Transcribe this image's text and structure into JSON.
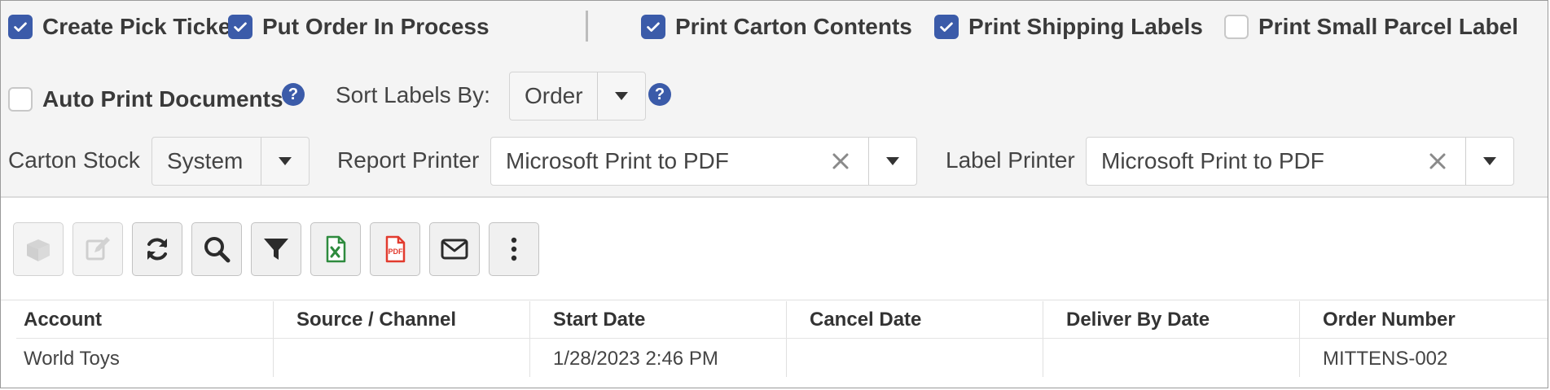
{
  "options": {
    "create_pick_tickets": {
      "label": "Create Pick Tickets",
      "checked": true
    },
    "put_order_in_process": {
      "label": "Put Order In Process",
      "checked": true
    },
    "print_carton_contents": {
      "label": "Print Carton Contents",
      "checked": true
    },
    "print_shipping_labels": {
      "label": "Print Shipping Labels",
      "checked": true
    },
    "print_small_parcel_label": {
      "label": "Print Small Parcel Label",
      "checked": false
    },
    "auto_print_documents": {
      "label": "Auto Print Documents",
      "checked": false
    }
  },
  "help_glyph": "?",
  "sort_labels": {
    "label": "Sort Labels By:",
    "value": "Order"
  },
  "carton_stock": {
    "label": "Carton Stock",
    "value": "System"
  },
  "report_printer": {
    "label": "Report Printer",
    "value": "Microsoft Print to PDF"
  },
  "label_printer": {
    "label": "Label Printer",
    "value": "Microsoft Print to PDF"
  },
  "toolbar": {
    "buttons": [
      {
        "icon": "box-icon",
        "enabled": false
      },
      {
        "icon": "edit-icon",
        "enabled": false
      },
      {
        "icon": "refresh-icon",
        "enabled": true
      },
      {
        "icon": "search-icon",
        "enabled": true
      },
      {
        "icon": "filter-icon",
        "enabled": true
      },
      {
        "icon": "excel-export-icon",
        "enabled": true
      },
      {
        "icon": "pdf-export-icon",
        "enabled": true
      },
      {
        "icon": "email-icon",
        "enabled": true
      },
      {
        "icon": "more-options-icon",
        "enabled": true
      }
    ],
    "pdf_text": "PDF"
  },
  "colors": {
    "checkbox_accent": "#3b5ba9",
    "excel_green": "#2e8b3e",
    "pdf_red": "#e23b2e"
  },
  "table": {
    "columns": [
      "Account",
      "Source / Channel",
      "Start Date",
      "Cancel Date",
      "Deliver By Date",
      "Order Number"
    ],
    "rows": [
      [
        "World Toys",
        "",
        "1/28/2023 2:46 PM",
        "",
        "",
        "MITTENS-002"
      ]
    ]
  }
}
